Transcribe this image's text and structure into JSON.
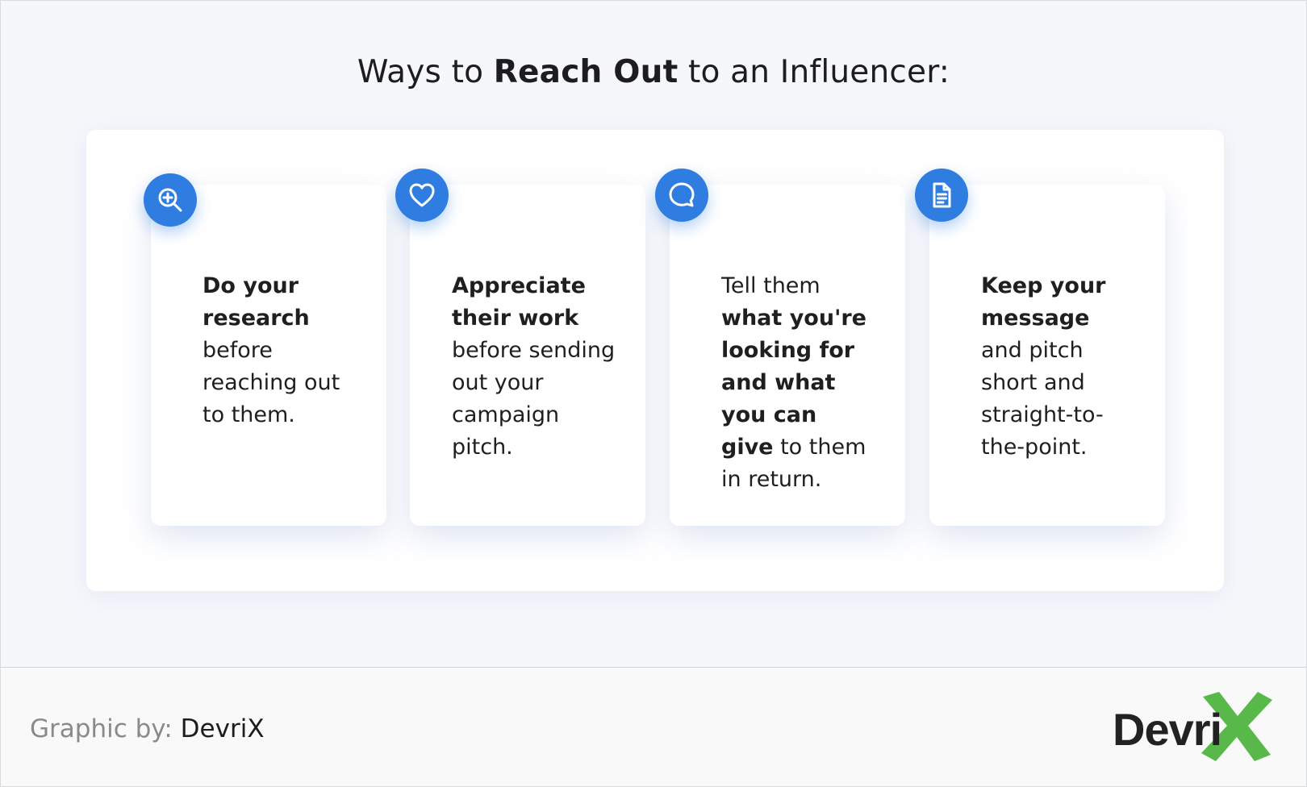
{
  "title": {
    "prefix": "Ways to",
    "bold": "Reach Out",
    "suffix": "to an Influencer:"
  },
  "cards": [
    {
      "icon": "zoom-in-icon",
      "parts": [
        {
          "t": "Do your research",
          "b": true
        },
        {
          "t": " before reaching out to them.",
          "b": false
        }
      ]
    },
    {
      "icon": "heart-icon",
      "parts": [
        {
          "t": "Appreciate their work",
          "b": true
        },
        {
          "t": " before sending out your campaign pitch.",
          "b": false
        }
      ]
    },
    {
      "icon": "chat-bubble-icon",
      "parts": [
        {
          "t": "Tell them ",
          "b": false
        },
        {
          "t": "what you're looking for and what you can give",
          "b": true
        },
        {
          "t": " to them in return.",
          "b": false
        }
      ]
    },
    {
      "icon": "document-icon",
      "parts": [
        {
          "t": "Keep your message",
          "b": true
        },
        {
          "t": " and pitch short and straight-to-the-point.",
          "b": false
        }
      ]
    }
  ],
  "footer": {
    "credit_label": "Graphic by:",
    "credit_name": "DevriX",
    "logo_text": "Devri",
    "logo_mark": "X"
  },
  "colors": {
    "accent": "#2f7de1",
    "logo_green": "#58b94a",
    "background": "#f5f7fb"
  }
}
